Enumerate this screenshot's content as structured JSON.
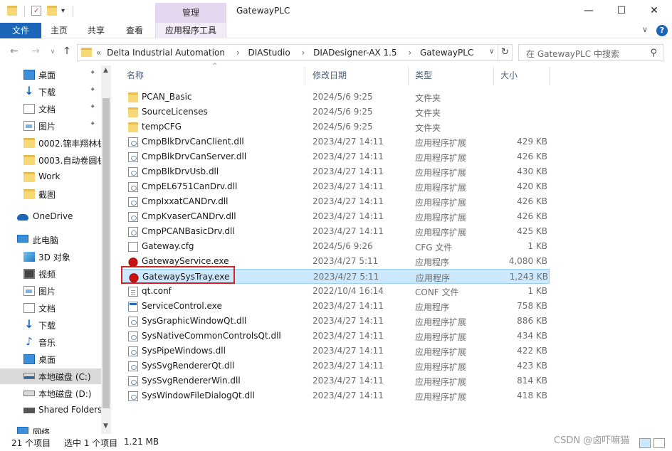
{
  "window": {
    "title": "GatewayPLC",
    "context_tab": "管理",
    "min_glyph": "—",
    "max_glyph": "☐",
    "close_glyph": "✕"
  },
  "quick_access": {
    "dropdown_glyph": "▾"
  },
  "ribbon": {
    "tabs": [
      "文件",
      "主页",
      "共享",
      "查看",
      "应用程序工具"
    ],
    "chevron_glyph": "∨",
    "help_glyph": "?"
  },
  "address": {
    "overflow": "«",
    "segments": [
      "Delta Industrial Automation",
      "DIAStudio",
      "DIADesigner-AX 1.5",
      "GatewayPLC"
    ],
    "separator": "›",
    "dropdown_glyph": "∨",
    "refresh_glyph": "↻"
  },
  "nav_buttons": {
    "back": "←",
    "forward": "→",
    "recent": "∨",
    "up": "↑"
  },
  "search": {
    "placeholder": "在 GatewayPLC 中搜索",
    "icon": "search-icon"
  },
  "sidebar": {
    "items": [
      {
        "label": "桌面",
        "icon": "desktop-icon",
        "pinned": true
      },
      {
        "label": "下载",
        "icon": "download-icon",
        "pinned": true
      },
      {
        "label": "文档",
        "icon": "document-icon",
        "pinned": true
      },
      {
        "label": "图片",
        "icon": "picture-icon",
        "pinned": true
      },
      {
        "label": "0002.锦丰翔林机",
        "icon": "folder-icon",
        "pinned": false
      },
      {
        "label": "0003.自动卷圆机",
        "icon": "folder-icon",
        "pinned": false
      },
      {
        "label": "Work",
        "icon": "folder-icon",
        "pinned": false
      },
      {
        "label": "截图",
        "icon": "folder-icon",
        "pinned": false
      },
      {
        "label": "OneDrive",
        "icon": "onedrive-icon",
        "pinned": false
      },
      {
        "label": "此电脑",
        "icon": "computer-icon",
        "pinned": false
      },
      {
        "label": "3D 对象",
        "icon": "3d-objects-icon",
        "pinned": false
      },
      {
        "label": "视频",
        "icon": "video-icon",
        "pinned": false
      },
      {
        "label": "图片",
        "icon": "picture-icon",
        "pinned": false
      },
      {
        "label": "文档",
        "icon": "document-icon",
        "pinned": false
      },
      {
        "label": "下载",
        "icon": "download-icon",
        "pinned": false
      },
      {
        "label": "音乐",
        "icon": "music-icon",
        "pinned": false
      },
      {
        "label": "桌面",
        "icon": "desktop-icon",
        "pinned": false
      },
      {
        "label": "本地磁盘 (C:)",
        "icon": "drive-c-icon",
        "pinned": false
      },
      {
        "label": "本地磁盘 (D:)",
        "icon": "drive-icon",
        "pinned": false
      },
      {
        "label": "Shared Folders",
        "icon": "network-drive-icon",
        "pinned": false
      },
      {
        "label": "网络",
        "icon": "network-icon",
        "pinned": false
      }
    ],
    "selected_index": 17,
    "pin_glyph": "📌",
    "scroll_up_glyph": "▲",
    "scroll_down_glyph": "▼"
  },
  "columns": {
    "name": "名称",
    "date": "修改日期",
    "type": "类型",
    "size": "大小",
    "sort_glyph": "^"
  },
  "files": [
    {
      "name": "PCAN_Basic",
      "date": "2024/5/6 9:25",
      "type": "文件夹",
      "size": "",
      "icon": "folder-icon"
    },
    {
      "name": "SourceLicenses",
      "date": "2024/5/6 9:25",
      "type": "文件夹",
      "size": "",
      "icon": "folder-icon"
    },
    {
      "name": "tempCFG",
      "date": "2024/5/6 9:25",
      "type": "文件夹",
      "size": "",
      "icon": "folder-icon"
    },
    {
      "name": "CmpBlkDrvCanClient.dll",
      "date": "2023/4/27 14:11",
      "type": "应用程序扩展",
      "size": "429 KB",
      "icon": "dll-icon"
    },
    {
      "name": "CmpBlkDrvCanServer.dll",
      "date": "2023/4/27 14:11",
      "type": "应用程序扩展",
      "size": "426 KB",
      "icon": "dll-icon"
    },
    {
      "name": "CmpBlkDrvUsb.dll",
      "date": "2023/4/27 14:11",
      "type": "应用程序扩展",
      "size": "430 KB",
      "icon": "dll-icon"
    },
    {
      "name": "CmpEL6751CanDrv.dll",
      "date": "2023/4/27 14:11",
      "type": "应用程序扩展",
      "size": "420 KB",
      "icon": "dll-icon"
    },
    {
      "name": "CmpIxxatCANDrv.dll",
      "date": "2023/4/27 14:11",
      "type": "应用程序扩展",
      "size": "426 KB",
      "icon": "dll-icon"
    },
    {
      "name": "CmpKvaserCANDrv.dll",
      "date": "2023/4/27 14:11",
      "type": "应用程序扩展",
      "size": "426 KB",
      "icon": "dll-icon"
    },
    {
      "name": "CmpPCANBasicDrv.dll",
      "date": "2023/4/27 14:11",
      "type": "应用程序扩展",
      "size": "425 KB",
      "icon": "dll-icon"
    },
    {
      "name": "Gateway.cfg",
      "date": "2024/5/6 9:26",
      "type": "CFG 文件",
      "size": "1 KB",
      "icon": "config-file-icon"
    },
    {
      "name": "GatewayService.exe",
      "date": "2023/4/27 5:11",
      "type": "应用程序",
      "size": "4,080 KB",
      "icon": "gateway-exe-icon"
    },
    {
      "name": "GatewaySysTray.exe",
      "date": "2023/4/27 5:11",
      "type": "应用程序",
      "size": "1,243 KB",
      "icon": "gateway-exe-icon"
    },
    {
      "name": "qt.conf",
      "date": "2022/10/4 16:14",
      "type": "CONF 文件",
      "size": "1 KB",
      "icon": "file-icon"
    },
    {
      "name": "ServiceControl.exe",
      "date": "2023/4/27 14:11",
      "type": "应用程序",
      "size": "758 KB",
      "icon": "service-exe-icon"
    },
    {
      "name": "SysGraphicWindowQt.dll",
      "date": "2023/4/27 14:11",
      "type": "应用程序扩展",
      "size": "886 KB",
      "icon": "dll-icon"
    },
    {
      "name": "SysNativeCommonControlsQt.dll",
      "date": "2023/4/27 14:11",
      "type": "应用程序扩展",
      "size": "434 KB",
      "icon": "dll-icon"
    },
    {
      "name": "SysPipeWindows.dll",
      "date": "2023/4/27 14:11",
      "type": "应用程序扩展",
      "size": "422 KB",
      "icon": "dll-icon"
    },
    {
      "name": "SysSvgRendererQt.dll",
      "date": "2023/4/27 14:11",
      "type": "应用程序扩展",
      "size": "423 KB",
      "icon": "dll-icon"
    },
    {
      "name": "SysSvgRendererWin.dll",
      "date": "2023/4/27 14:11",
      "type": "应用程序扩展",
      "size": "814 KB",
      "icon": "dll-icon"
    },
    {
      "name": "SysWindowFileDialogQt.dll",
      "date": "2023/4/27 14:11",
      "type": "应用程序扩展",
      "size": "418 KB",
      "icon": "dll-icon"
    }
  ],
  "selected_file_index": 12,
  "status": {
    "count": "21 个项目",
    "selected": "选中 1 个项目",
    "size": "1.21 MB"
  },
  "watermark": "CSDN @卤吓嘛猫",
  "colors": {
    "accent": "#1a65b8",
    "context_tab": "#e6d7f0",
    "selection": "#cce8ff",
    "highlight_box": "#d32222"
  }
}
